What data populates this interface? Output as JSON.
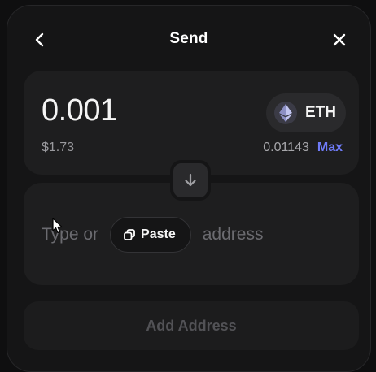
{
  "header": {
    "title": "Send",
    "back_icon": "chevron-left-icon",
    "close_icon": "close-icon"
  },
  "amount": {
    "value": "0.001",
    "fiat": "$1.73",
    "token_symbol": "ETH",
    "token_icon": "ethereum-icon",
    "balance": "0.01143",
    "max_label": "Max"
  },
  "swap": {
    "icon": "arrow-down-icon"
  },
  "address": {
    "prefix": "Type or",
    "paste_label": "Paste",
    "paste_icon": "copy-icon",
    "suffix": "address"
  },
  "add_address_label": "Add Address",
  "colors": {
    "accent": "#6f7bf7",
    "background": "#151516",
    "card": "#1e1e1f"
  }
}
